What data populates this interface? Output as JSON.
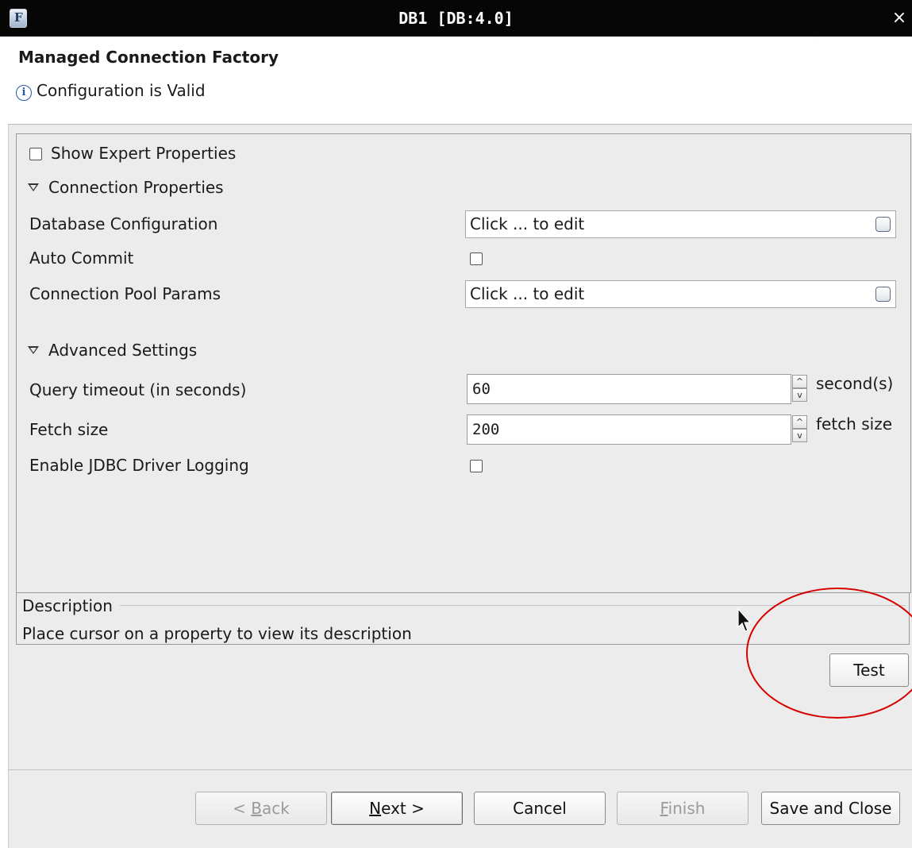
{
  "window": {
    "title": "DB1 [DB:4.0]",
    "close_glyph": "×",
    "app_icon": "F"
  },
  "header": {
    "heading": "Managed Connection Factory",
    "status_icon": "info-icon",
    "status_text": "Configuration is Valid"
  },
  "panel": {
    "show_expert": {
      "label": "Show Expert Properties",
      "checked": false
    },
    "connection_section": {
      "label": "Connection Properties"
    },
    "database_configuration": {
      "label": "Database Configuration",
      "value": "Click ... to edit"
    },
    "auto_commit": {
      "label": "Auto Commit",
      "checked": false
    },
    "connection_pool_params": {
      "label": "Connection Pool Params",
      "value": "Click ... to edit"
    },
    "advanced_section": {
      "label": "Advanced Settings"
    },
    "query_timeout": {
      "label": "Query timeout (in seconds)",
      "value": "60",
      "unit": "second(s)"
    },
    "fetch_size": {
      "label": "Fetch size",
      "value": "200",
      "unit": "fetch size"
    },
    "jdbc_logging": {
      "label": "Enable JDBC Driver Logging",
      "checked": false
    }
  },
  "description": {
    "title": "Description",
    "text": "Place cursor on a property to view its description"
  },
  "test_button": {
    "label": "Test"
  },
  "footer": {
    "back": {
      "prefix": "< ",
      "mnemonic": "B",
      "rest": "ack"
    },
    "next": {
      "mnemonic": "N",
      "rest": "ext >"
    },
    "cancel": "Cancel",
    "finish": {
      "mnemonic": "F",
      "rest": "inish"
    },
    "save_close": "Save and Close"
  },
  "colors": {
    "annotation": "#d60000",
    "title_bar": "#060606",
    "window_bg": "#ececec"
  }
}
